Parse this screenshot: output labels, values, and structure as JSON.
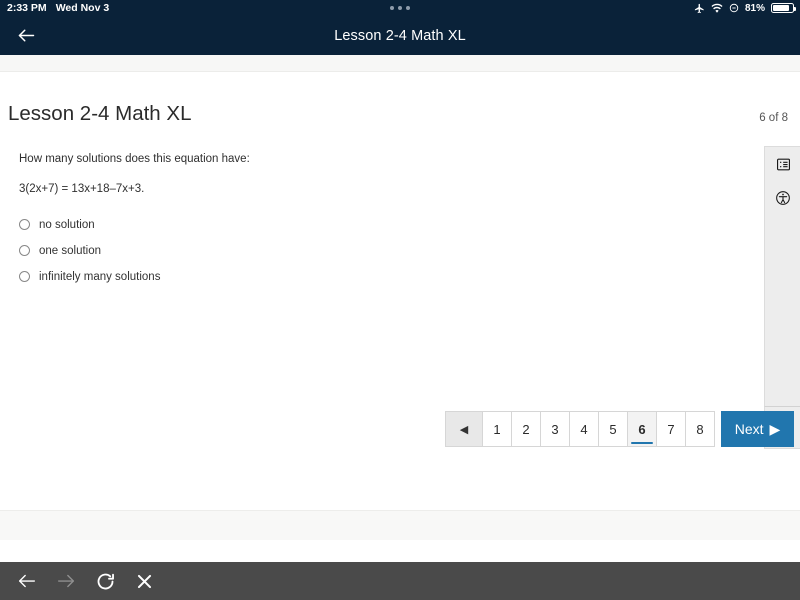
{
  "status_bar": {
    "time": "2:33 PM",
    "date": "Wed Nov 3",
    "battery_percent": "81%",
    "icons": [
      "airplane-mode-icon",
      "wifi-icon",
      "do-not-disturb-icon",
      "battery-icon"
    ],
    "multitask_indicator": "three-dots"
  },
  "nav": {
    "back_icon": "back-arrow-icon",
    "title": "Lesson 2-4 Math XL"
  },
  "content": {
    "page_title": "Lesson 2-4 Math XL",
    "counter": "6 of 8",
    "question_prompt": "How many solutions does this equation have:",
    "equation": "3(2x+7) = 13x+18–7x+3.",
    "choices": [
      {
        "label": "no solution",
        "selected": false
      },
      {
        "label": "one solution",
        "selected": false
      },
      {
        "label": "infinitely many solutions",
        "selected": false
      }
    ]
  },
  "tool_rail": {
    "buttons": [
      {
        "name": "question-list-icon"
      },
      {
        "name": "accessibility-icon"
      }
    ],
    "collapse_icon": "chevron-left-icon"
  },
  "pagination": {
    "prev_label": "◀",
    "pages": [
      "1",
      "2",
      "3",
      "4",
      "5",
      "6",
      "7",
      "8"
    ],
    "active_page": "6",
    "next_label": "Next",
    "next_arrow": "▶"
  },
  "browser_toolbar": {
    "buttons": [
      {
        "name": "back-arrow-icon",
        "enabled": true
      },
      {
        "name": "forward-arrow-icon",
        "enabled": false
      },
      {
        "name": "reload-icon",
        "enabled": true
      },
      {
        "name": "close-icon",
        "enabled": true
      }
    ]
  },
  "colors": {
    "header": "#0a2239",
    "accent_blue": "#2176ae",
    "toolbar": "#4a4a4a",
    "rail_bg": "#ededed"
  }
}
